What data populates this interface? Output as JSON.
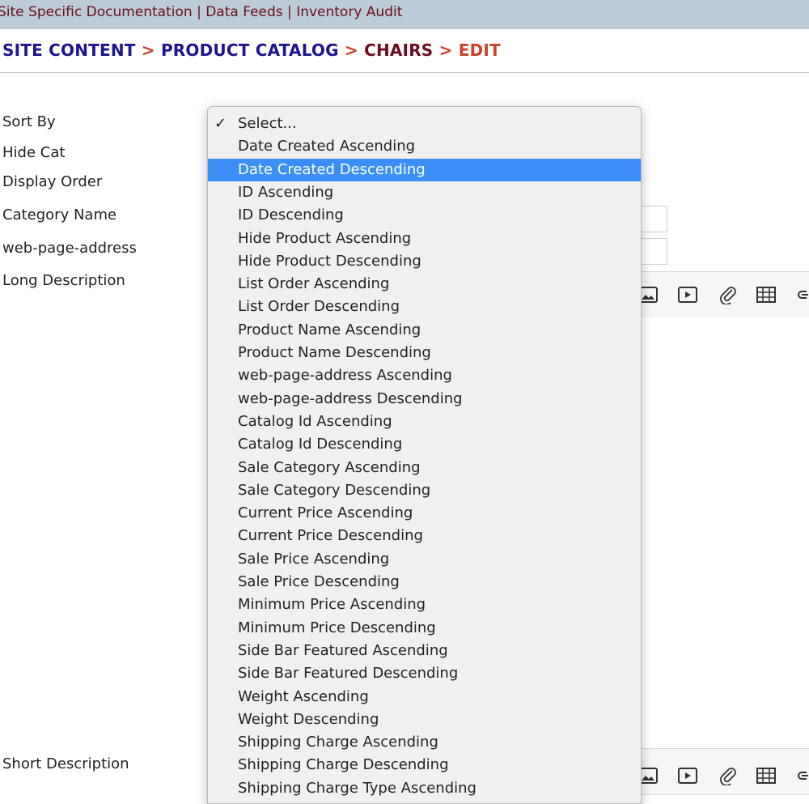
{
  "topnav": {
    "items": [
      "Site Specific Documentation",
      "Data Feeds",
      "Inventory Audit"
    ],
    "separator": "|"
  },
  "breadcrumb": {
    "items": [
      "SITE CONTENT",
      "PRODUCT CATALOG",
      "CHAIRS",
      "EDIT"
    ],
    "separator": ">"
  },
  "form": {
    "labels": {
      "sort_by": "Sort By",
      "hide_cat": "Hide Cat",
      "display_order": "Display Order",
      "category_name": "Category Name",
      "web_page_address": "web-page-address",
      "long_description": "Long Description",
      "short_description": "Short Description"
    }
  },
  "sort_dropdown": {
    "checked_option": "Select...",
    "highlighted_option": "Date Created Descending",
    "check_glyph": "✓",
    "options": [
      "Select...",
      "Date Created Ascending",
      "Date Created Descending",
      "ID Ascending",
      "ID Descending",
      "Hide Product Ascending",
      "Hide Product Descending",
      "List Order Ascending",
      "List Order Descending",
      "Product Name Ascending",
      "Product Name Descending",
      "web-page-address Ascending",
      "web-page-address Descending",
      "Catalog Id Ascending",
      "Catalog Id Descending",
      "Sale Category Ascending",
      "Sale Category Descending",
      "Current Price Ascending",
      "Current Price Descending",
      "Sale Price Ascending",
      "Sale Price Descending",
      "Minimum Price Ascending",
      "Minimum Price Descending",
      "Side Bar Featured Ascending",
      "Side Bar Featured Descending",
      "Weight Ascending",
      "Weight Descending",
      "Shipping Charge Ascending",
      "Shipping Charge Descending",
      "Shipping Charge Type Ascending"
    ]
  },
  "editor_toolbar": {
    "icons": [
      "image-icon",
      "video-icon",
      "attachment-icon",
      "table-icon",
      "link-icon"
    ]
  },
  "colors": {
    "topbar_bg": "#bccbd8",
    "topnav_text": "#6b0d1e",
    "breadcrumb_link": "#1e1491",
    "breadcrumb_separator": "#c8442a",
    "breadcrumb_current": "#6b0d1e",
    "highlight": "#3b8ff6"
  }
}
